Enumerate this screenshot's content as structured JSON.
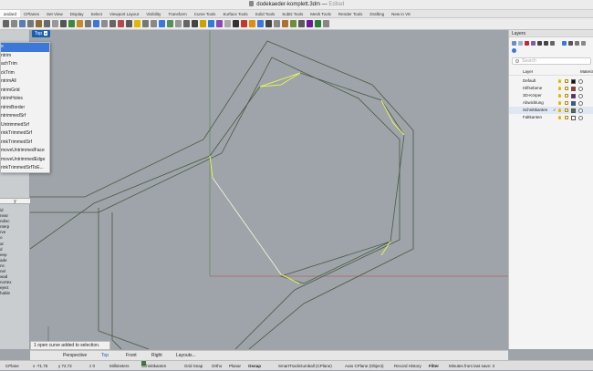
{
  "title_bar": {
    "filename": "dodekaeder-komplett.3dm",
    "status": "Edited"
  },
  "toolbar_tabs": [
    "andard",
    "CPlanes",
    "Set View",
    "Display",
    "Select",
    "Viewport Layout",
    "Visibility",
    "Transform",
    "Curve Tools",
    "Surface Tools",
    "Solid Tools",
    "SubD Tools",
    "Mesh Tools",
    "Render Tools",
    "Drafting",
    "New in V8"
  ],
  "viewport": {
    "name": "Top",
    "dropdown": "▾"
  },
  "popup_menu": {
    "items": [
      "e",
      "ntrim",
      "achTrim",
      "ckTrim",
      "ntrimAll",
      "ntrimGrid",
      "ntrimHoles",
      "ntrimBorder",
      "ntrimmedSrf",
      "UntrimmedSrf",
      "rinkTrimmedSrf",
      "rinkTrimmedSrf",
      "moveUntrimmedFace",
      "moveUntrimmedEdge",
      "rinkTrimmedSrfToE..."
    ],
    "selected_index": 0
  },
  "left_panel": {
    "search_icon": "y",
    "items": [
      "id",
      "near",
      "ndisc",
      "nterp",
      "rve",
      "o",
      "ar",
      "d",
      "eep",
      "ade",
      "ns",
      "nel",
      "wad",
      "nortex",
      "eject",
      "",
      "hable"
    ]
  },
  "layers_panel": {
    "title": "Layers",
    "search_placeholder": "Search",
    "col_layer": "Layer",
    "col_material": "Materia",
    "layers": [
      {
        "name": "Default",
        "color": "#111111",
        "current": false
      },
      {
        "name": "Hilfsebene",
        "color": "#c62828",
        "current": false
      },
      {
        "name": "3D-Körper",
        "color": "#6a1b9a",
        "current": false
      },
      {
        "name": "Abwicklung",
        "color": "#1565c0",
        "current": false
      },
      {
        "name": "Schnittkanten",
        "color": "#3e7a3e",
        "current": true,
        "check": "✓"
      },
      {
        "name": "Faltkanten",
        "color": "#ffffff",
        "current": false
      }
    ]
  },
  "command_line": "1 open curve added to selection.",
  "view_tabs": [
    "Perspective",
    "Top",
    "Front",
    "Right",
    "Layouts..."
  ],
  "view_tab_active": "Top",
  "status_bar": {
    "cplane": "CPlane",
    "x": "x -71.75",
    "y": "y 72.72",
    "z": "z 0",
    "units": "Millimeters",
    "layer": "Schnittkanten",
    "toggles": [
      "Grid Snap",
      "Ortho",
      "Planar",
      "Osnap",
      "SmartTrack",
      "Gumball (CPlane)",
      "Auto CPlane (Object)",
      "Record History",
      "Filter"
    ],
    "active_toggles": [
      "Osnap",
      "Filter"
    ],
    "last_save": "Minutes from last save: 3"
  },
  "colors": {
    "accent": "#1a5fb4",
    "viewport_bg": "#9ea4a9",
    "curve": "#4a5a44",
    "highlight": "#e4f25a"
  }
}
